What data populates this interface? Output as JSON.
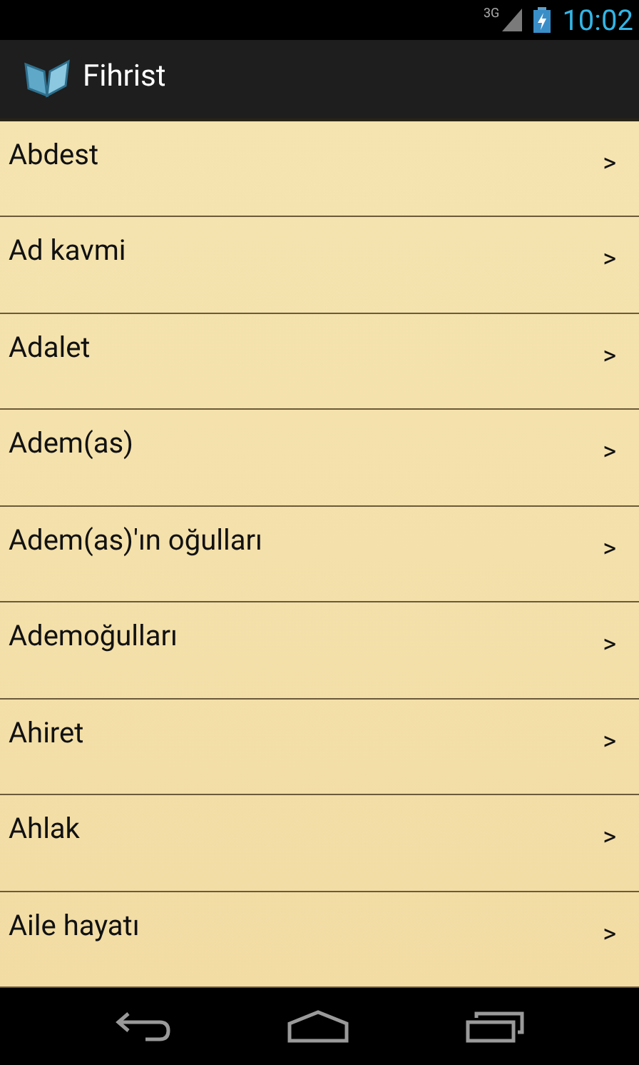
{
  "status_bar": {
    "network": "3G",
    "time": "10:02"
  },
  "action_bar": {
    "title": "Fihrist"
  },
  "items": [
    {
      "label": "Abdest",
      "chevron": ">"
    },
    {
      "label": "Ad kavmi",
      "chevron": ">"
    },
    {
      "label": "Adalet",
      "chevron": ">"
    },
    {
      "label": "Adem(as)",
      "chevron": ">"
    },
    {
      "label": "Adem(as)'ın oğulları",
      "chevron": ">"
    },
    {
      "label": "Ademoğulları",
      "chevron": ">"
    },
    {
      "label": "Ahiret",
      "chevron": ">"
    },
    {
      "label": "Ahlak",
      "chevron": ">"
    },
    {
      "label": "Aile hayatı",
      "chevron": ">"
    }
  ]
}
